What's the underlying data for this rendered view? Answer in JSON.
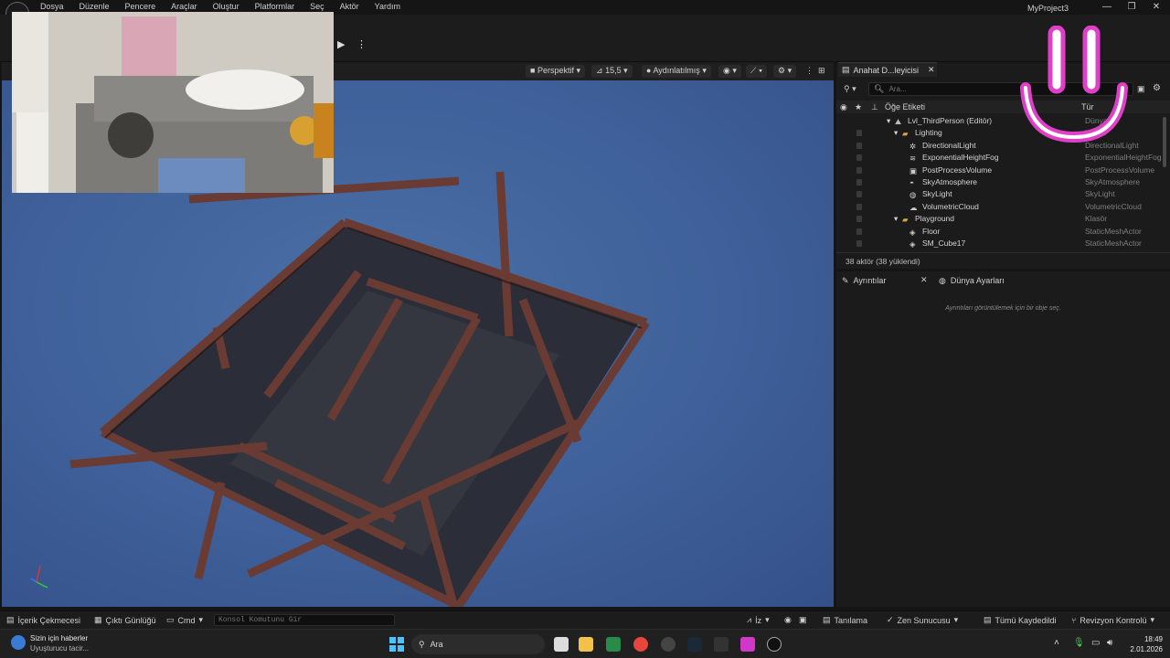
{
  "menu": [
    "Dosya",
    "Düzenle",
    "Pencere",
    "Araçlar",
    "Oluştur",
    "Platformlar",
    "Seç",
    "Aktör",
    "Yardım"
  ],
  "project_title": "MyProject3",
  "window_controls": {
    "minimize": "—",
    "restore": "❐",
    "close": "✕"
  },
  "viewport": {
    "perspective_label": "Perspektif",
    "fov_label": "15,5",
    "lighting_label": "Aydınlatılmış"
  },
  "outliner": {
    "tab_label": "Anahat D...leyicisi",
    "search_placeholder": "Ara...",
    "col_label": "Öğe Etiketi",
    "col_type": "Tür",
    "rows": [
      {
        "label": "Lvl_ThirdPerson (Editör)",
        "type": "Dünya"
      },
      {
        "label": "Lighting",
        "type": "Klasör"
      },
      {
        "label": "DirectionalLight",
        "type": "DirectionalLight"
      },
      {
        "label": "ExponentialHeightFog",
        "type": "ExponentialHeightFog"
      },
      {
        "label": "PostProcessVolume",
        "type": "PostProcessVolume"
      },
      {
        "label": "SkyAtmosphere",
        "type": "SkyAtmosphere"
      },
      {
        "label": "SkyLight",
        "type": "SkyLight"
      },
      {
        "label": "VolumetricCloud",
        "type": "VolumetricCloud"
      },
      {
        "label": "Playground",
        "type": "Klasör"
      },
      {
        "label": "Floor",
        "type": "StaticMeshActor"
      },
      {
        "label": "SM_Cube17",
        "type": "StaticMeshActor"
      }
    ],
    "footer": "38 aktör (38 yüklendi)"
  },
  "details": {
    "tab_details": "Ayrıntılar",
    "tab_world": "Dünya Ayarları",
    "empty_message": "Ayrıntıları görüntülemek için bir obje seç."
  },
  "bottombar": {
    "content_drawer": "İçerik Çekmecesi",
    "output_log": "Çıktı Günlüğü",
    "cmd": "Cmd",
    "console_placeholder": "Konsol Komutunu Gir",
    "trace": "İz",
    "diagnostics": "Tanılama",
    "zen": "Zen Sunucusu",
    "saved": "Tümü Kaydedildi",
    "revision": "Revizyon Kontrolü"
  },
  "taskbar": {
    "news_title": "Sizin için haberler",
    "news_sub": "Uyuşturucu tacir...",
    "search_label": "Ara",
    "time": "18:49",
    "date": "2.01.2026"
  },
  "colors": {
    "accent": "#3a7bd5",
    "folder": "#d9a441",
    "smiley": "#e040c8",
    "sky": "#4a6fa5"
  }
}
